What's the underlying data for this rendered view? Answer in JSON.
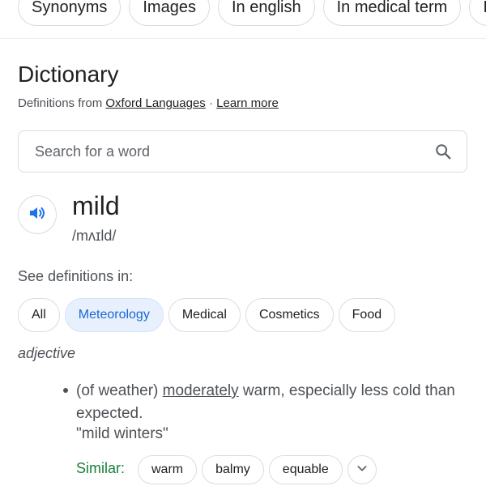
{
  "top_chips": [
    "Synonyms",
    "Images",
    "In english",
    "In medical term",
    "In"
  ],
  "dictionary": {
    "title": "Dictionary",
    "source_prefix": "Definitions from ",
    "source_link": "Oxford Languages",
    "separator": " · ",
    "learn_more": "Learn more"
  },
  "search": {
    "placeholder": "Search for a word",
    "icon": "search-icon"
  },
  "entry": {
    "speaker_icon": "speaker-icon",
    "word": "mild",
    "phonetic": "/mʌɪld/",
    "see_definitions_label": "See definitions in:",
    "categories": [
      {
        "label": "All",
        "selected": false
      },
      {
        "label": "Meteorology",
        "selected": true
      },
      {
        "label": "Medical",
        "selected": false
      },
      {
        "label": "Cosmetics",
        "selected": false
      },
      {
        "label": "Food",
        "selected": false
      }
    ],
    "part_of_speech": "adjective",
    "definition": {
      "prefix": "(of weather) ",
      "link_word": "moderately",
      "suffix": " warm, especially less cold than expected.",
      "example": "\"mild winters\""
    },
    "similar_label": "Similar:",
    "similar": [
      "warm",
      "balmy",
      "equable"
    ],
    "expand_icon": "chevron-down-icon"
  },
  "colors": {
    "accent_blue": "#1a73e8",
    "selected_chip_bg": "#e8f0fe",
    "similar_green": "#188038"
  }
}
